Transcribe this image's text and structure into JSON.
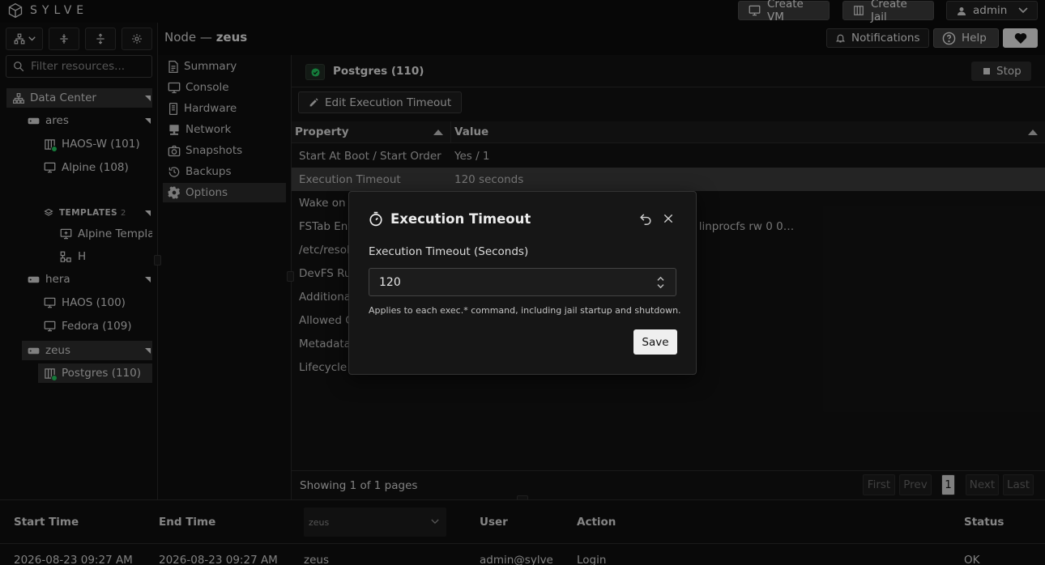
{
  "app": {
    "brand": "SYLVE"
  },
  "topbar": {
    "create_vm": "Create VM",
    "create_jail": "Create Jail",
    "user": "admin"
  },
  "sidebar": {
    "filter_placeholder": "Filter resources...",
    "tree": [
      {
        "label": "Data Center",
        "icon": "datacenter-icon"
      },
      {
        "label": "ares",
        "icon": "server-icon"
      },
      {
        "label": "HAOS-W (101)",
        "icon": "jail-icon",
        "status": "running"
      },
      {
        "label": "Alpine (108)",
        "icon": "monitor-icon"
      },
      {
        "label": "TEMPLATES",
        "count": "2",
        "icon": "layers-icon"
      },
      {
        "label": "Alpine Templat",
        "icon": "template-monitor-icon"
      },
      {
        "label": "H",
        "icon": "template-network-icon"
      },
      {
        "label": "hera",
        "icon": "server-icon"
      },
      {
        "label": "HAOS (100)",
        "icon": "monitor-icon"
      },
      {
        "label": "Fedora (109)",
        "icon": "monitor-icon"
      },
      {
        "label": "zeus",
        "icon": "server-icon"
      },
      {
        "label": "Postgres (110)",
        "icon": "jail-icon",
        "status": "running"
      }
    ]
  },
  "header": {
    "node_prefix": "Node —",
    "node_name": "zeus",
    "notifications": "Notifications",
    "help": "Help"
  },
  "nav": {
    "items": [
      "Summary",
      "Console",
      "Hardware",
      "Network",
      "Snapshots",
      "Backups",
      "Options"
    ],
    "active": "Options"
  },
  "resource": {
    "title": "Postgres (110)",
    "stop": "Stop",
    "edit_button": "Edit Execution Timeout"
  },
  "table": {
    "columns": [
      "Property",
      "Value"
    ],
    "rows": [
      {
        "property": "Start At Boot / Start Order",
        "value": "Yes / 1"
      },
      {
        "property": "Execution Timeout",
        "value": "120 seconds"
      },
      {
        "property": "Wake on L",
        "value": ""
      },
      {
        "property": "FSTab Ent",
        "value": "c linprocfs rw 0 0…"
      },
      {
        "property": "/etc/resol",
        "value": ""
      },
      {
        "property": "DevFS Rul",
        "value": ""
      },
      {
        "property": "Additiona",
        "value": ""
      },
      {
        "property": "Allowed O",
        "value": ""
      },
      {
        "property": "Metadata",
        "value": ""
      },
      {
        "property": "Lifecycle H",
        "value": ""
      }
    ],
    "footer": "Showing 1 of 1 pages",
    "pagination": {
      "first": "First",
      "prev": "Prev",
      "page": "1",
      "next": "Next",
      "last": "Last"
    }
  },
  "log": {
    "columns": {
      "start": "Start Time",
      "end": "End Time",
      "filter_value": "zeus",
      "user": "User",
      "action": "Action",
      "status": "Status"
    },
    "row": {
      "start": "2026-08-23 09:27 AM",
      "end": "2026-08-23 09:27 AM",
      "node": "zeus",
      "user": "admin@sylve",
      "action": "Login",
      "status": "OK"
    }
  },
  "modal": {
    "title": "Execution Timeout",
    "label": "Execution Timeout (Seconds)",
    "value": "120",
    "help": "Applies to each exec.* command, including jail startup and shutdown.",
    "save": "Save"
  },
  "colors": {
    "running": "#22c55e",
    "selected_row": "#3a3a3a",
    "background": "#0c0c0c"
  }
}
